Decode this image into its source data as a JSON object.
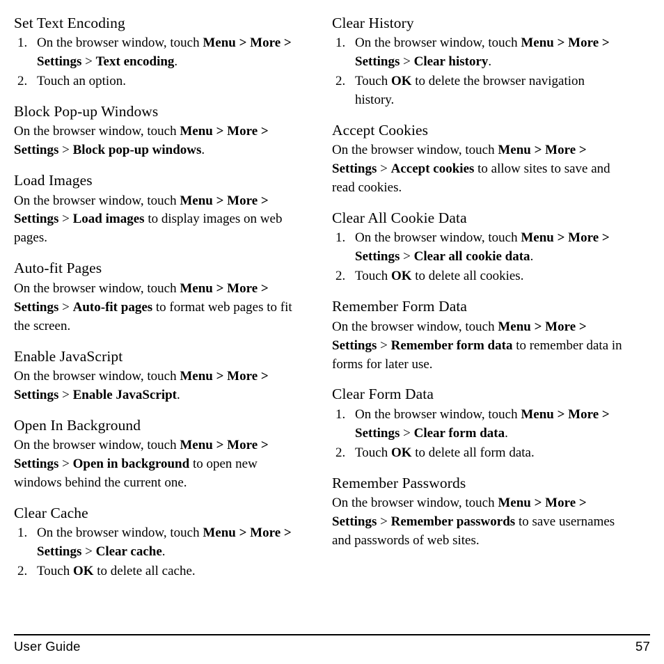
{
  "document": {
    "breadcrumb_tokens": {
      "intro": "On the browser window, touch ",
      "menu": "Menu",
      "more": "More",
      "settings": "Settings",
      "sep": ">"
    },
    "footer": {
      "label": "User Guide",
      "page_number": "57"
    }
  },
  "left_column": [
    {
      "id": "set-text-encoding",
      "heading": "Set Text Encoding",
      "type": "ordered",
      "steps": [
        {
          "num": "1.",
          "lead": "On the browser window, touch ",
          "path": [
            "Menu",
            "More",
            "Settings",
            "Text encoding"
          ],
          "tail": "."
        },
        {
          "num": "2.",
          "lead": "Touch an option.",
          "path": [],
          "tail": ""
        }
      ]
    },
    {
      "id": "block-pop-up-windows",
      "heading": "Block Pop-up Windows",
      "type": "paragraph",
      "lead": "On the browser window, touch ",
      "path": [
        "Menu",
        "More",
        "Settings",
        "Block pop-up windows"
      ],
      "tail": "."
    },
    {
      "id": "load-images",
      "heading": "Load Images",
      "type": "paragraph",
      "lead": "On the browser window, touch ",
      "path": [
        "Menu",
        "More",
        "Settings",
        "Load images"
      ],
      "tail": " to display images on web pages."
    },
    {
      "id": "auto-fit-pages",
      "heading": "Auto-fit Pages",
      "type": "paragraph",
      "lead": "On the browser window, touch ",
      "path": [
        "Menu",
        "More",
        "Settings",
        "Auto-fit pages"
      ],
      "tail": " to format web pages to fit the screen."
    },
    {
      "id": "enable-javascript",
      "heading": "Enable JavaScript",
      "type": "paragraph",
      "lead": "On the browser window, touch ",
      "path": [
        "Menu",
        "More",
        "Settings",
        "Enable JavaScript"
      ],
      "tail": "."
    },
    {
      "id": "open-in-background",
      "heading": "Open In Background",
      "type": "paragraph",
      "lead": "On the browser window, touch ",
      "path": [
        "Menu",
        "More",
        "Settings",
        "Open in background"
      ],
      "tail": " to open new windows behind the current one."
    },
    {
      "id": "clear-cache",
      "heading": "Clear Cache",
      "type": "ordered",
      "steps": [
        {
          "num": "1.",
          "lead": "On the browser window, touch ",
          "path": [
            "Menu",
            "More",
            "Settings",
            "Clear cache"
          ],
          "tail": "."
        },
        {
          "num": "2.",
          "lead": "Touch ",
          "path": [],
          "bold_inline": "OK",
          "tail": " to delete all cache."
        }
      ]
    }
  ],
  "right_column": [
    {
      "id": "clear-history",
      "heading": "Clear History",
      "type": "ordered",
      "steps": [
        {
          "num": "1.",
          "lead": "On the browser window, touch ",
          "path": [
            "Menu",
            "More",
            "Settings",
            "Clear history"
          ],
          "tail": "."
        },
        {
          "num": "2.",
          "lead": "Touch ",
          "path": [],
          "bold_inline": "OK",
          "tail": " to delete the browser navigation history."
        }
      ]
    },
    {
      "id": "accept-cookies",
      "heading": "Accept Cookies",
      "type": "paragraph",
      "lead": "On the browser window, touch ",
      "path": [
        "Menu",
        "More",
        "Settings",
        "Accept cookies"
      ],
      "tail": " to allow sites to save and read cookies."
    },
    {
      "id": "clear-all-cookie-data",
      "heading": "Clear All Cookie Data",
      "type": "ordered",
      "steps": [
        {
          "num": "1.",
          "lead": "On the browser window, touch ",
          "path": [
            "Menu",
            "More",
            "Settings",
            "Clear all cookie data"
          ],
          "tail": "."
        },
        {
          "num": "2.",
          "lead": "Touch ",
          "path": [],
          "bold_inline": "OK",
          "tail": " to delete all cookies."
        }
      ]
    },
    {
      "id": "remember-form-data",
      "heading": "Remember Form Data",
      "type": "paragraph",
      "lead": "On the browser window, touch ",
      "path": [
        "Menu",
        "More",
        "Settings",
        "Remember form data"
      ],
      "tail": " to remember data in forms for later use."
    },
    {
      "id": "clear-form-data",
      "heading": "Clear Form Data",
      "type": "ordered",
      "steps": [
        {
          "num": "1.",
          "lead": "On the browser window, touch ",
          "path": [
            "Menu",
            "More",
            "Settings",
            "Clear form data"
          ],
          "tail": "."
        },
        {
          "num": "2.",
          "lead": "Touch ",
          "path": [],
          "bold_inline": "OK",
          "tail": " to delete all form data."
        }
      ]
    },
    {
      "id": "remember-passwords",
      "heading": "Remember Passwords",
      "type": "paragraph",
      "lead": "On the browser window, touch ",
      "path": [
        "Menu",
        "More",
        "Settings",
        "Remember passwords"
      ],
      "tail": " to save usernames and passwords of web sites."
    }
  ]
}
